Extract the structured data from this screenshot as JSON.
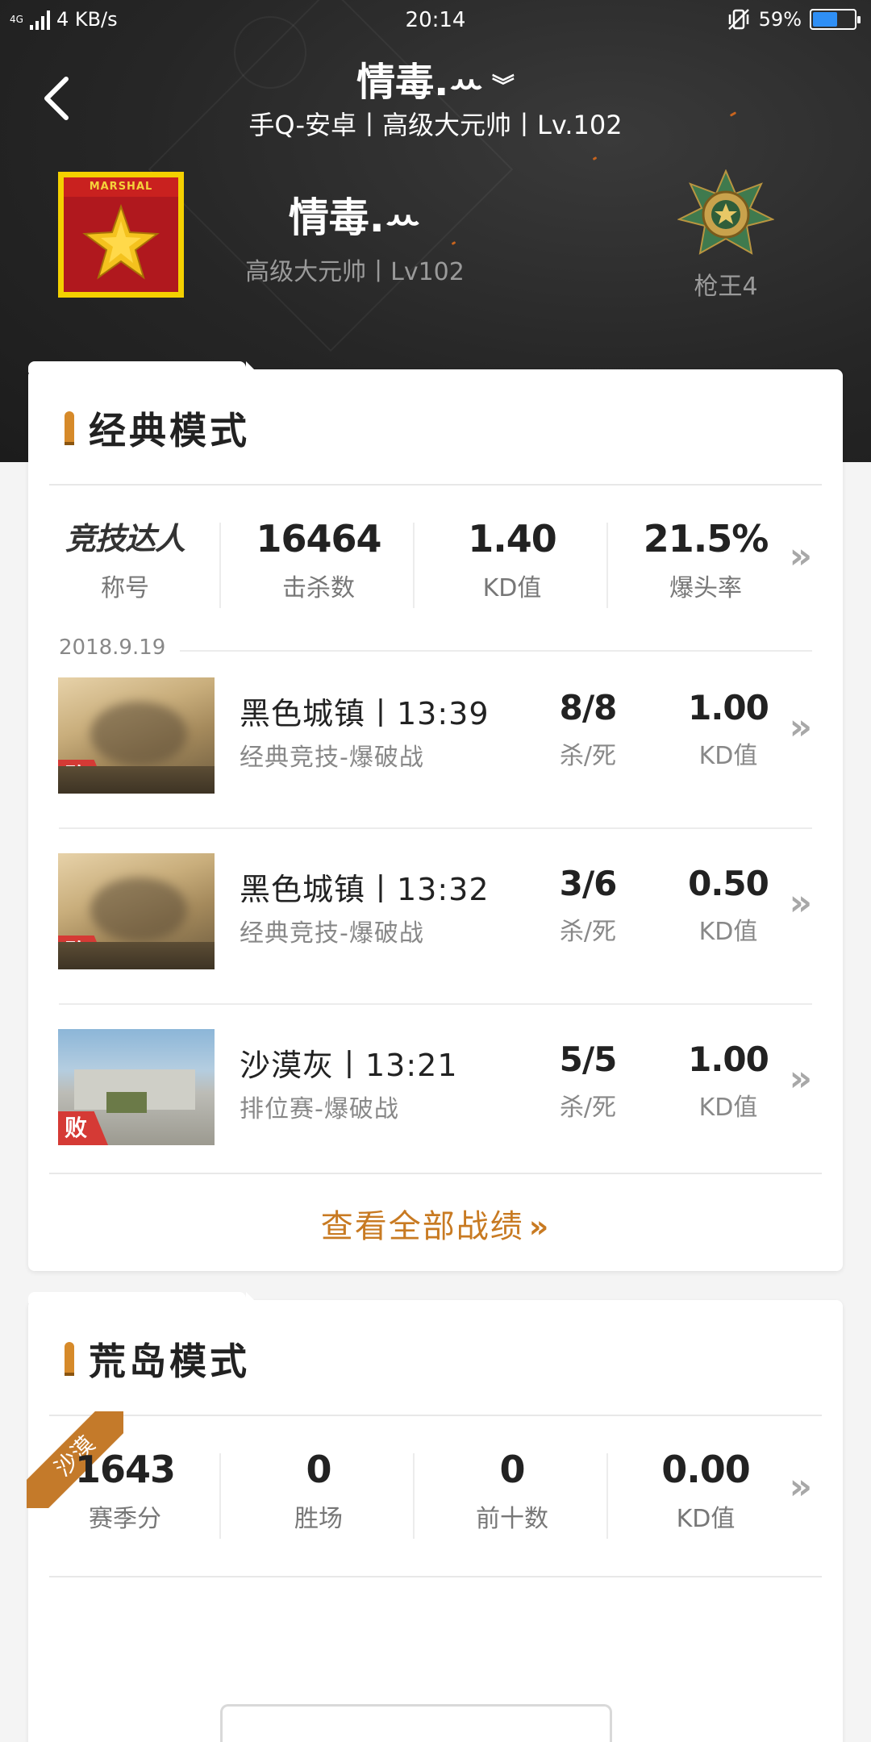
{
  "status_bar": {
    "network": "4G",
    "speed": "4 KB/s",
    "time": "20:14",
    "battery_percent": "59%",
    "battery_level": 0.59
  },
  "header": {
    "player_name": "情毒.ꕀ",
    "player_subtitle": "手Q-安卓丨高级大元帅丨Lv.102",
    "profile_name": "情毒.ꕀ",
    "profile_rank": "高级大元帅丨Lv102",
    "avatar_badge_text": "MARSHAL",
    "medal_label": "枪王4"
  },
  "classic_mode": {
    "title": "经典模式",
    "summary": {
      "title_badge": "竞技达人",
      "title_label": "称号",
      "kills": "16464",
      "kills_label": "击杀数",
      "kd": "1.40",
      "kd_label": "KD值",
      "headshot": "21.5%",
      "headshot_label": "爆头率"
    },
    "date": "2018.9.19",
    "matches": [
      {
        "result": "败",
        "title": "黑色城镇丨13:39",
        "mode": "经典竞技-爆破战",
        "kd_ratio": "8/8",
        "kd_ratio_label": "杀/死",
        "kd_value": "1.00",
        "kd_value_label": "KD值"
      },
      {
        "result": "败",
        "title": "黑色城镇丨13:32",
        "mode": "经典竞技-爆破战",
        "kd_ratio": "3/6",
        "kd_ratio_label": "杀/死",
        "kd_value": "0.50",
        "kd_value_label": "KD值"
      },
      {
        "result": "败",
        "title": "沙漠灰丨13:21",
        "mode": "排位赛-爆破战",
        "kd_ratio": "5/5",
        "kd_ratio_label": "杀/死",
        "kd_value": "1.00",
        "kd_value_label": "KD值"
      }
    ],
    "view_all": "查看全部战绩",
    "view_all_arrow": "»"
  },
  "island_mode": {
    "title": "荒岛模式",
    "ribbon": "沙漠",
    "stats": {
      "season_score": "1643",
      "season_score_label": "赛季分",
      "wins": "0",
      "wins_label": "胜场",
      "top_ten": "0",
      "top_ten_label": "前十数",
      "kd": "0.00",
      "kd_label": "KD值"
    }
  },
  "arrow_glyph": "»",
  "colors": {
    "accent": "#c87a22",
    "lose": "#d53a35",
    "battery": "#2f8ff5",
    "avatar_border": "#f4d000"
  },
  "icons": [
    "back-arrow-icon",
    "chevron-down-icon",
    "bullet-icon",
    "medal-icon",
    "marshal-star-icon",
    "double-chevron-right-icon"
  ]
}
